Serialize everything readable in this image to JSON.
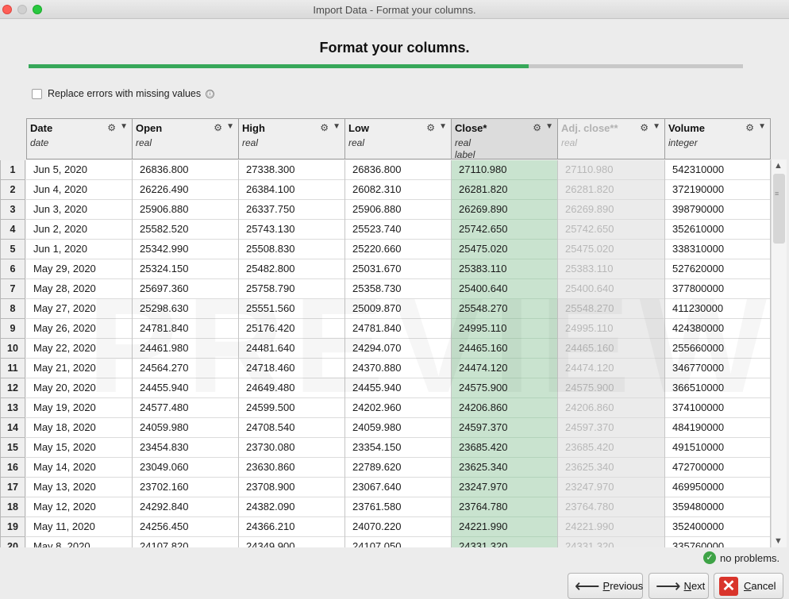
{
  "window": {
    "title": "Import Data - Format your columns."
  },
  "heading": "Format your columns.",
  "progress": {
    "percent": 70,
    "fill_color": "#37a85a"
  },
  "replace_errors": {
    "label": "Replace errors with missing values",
    "checked": false,
    "info_icon": "ⓘ"
  },
  "watermark": "PREVIEW",
  "columns": [
    {
      "name": "Date",
      "type": "date",
      "role": ""
    },
    {
      "name": "Open",
      "type": "real",
      "role": ""
    },
    {
      "name": "High",
      "type": "real",
      "role": ""
    },
    {
      "name": "Low",
      "type": "real",
      "role": ""
    },
    {
      "name": "Close*",
      "type": "real",
      "role": "label"
    },
    {
      "name": "Adj. close**",
      "type": "real",
      "role": ""
    },
    {
      "name": "Volume",
      "type": "integer",
      "role": ""
    }
  ],
  "rows": [
    {
      "n": "1",
      "cells": [
        "Jun 5, 2020",
        "26836.800",
        "27338.300",
        "26836.800",
        "27110.980",
        "27110.980",
        "542310000"
      ]
    },
    {
      "n": "2",
      "cells": [
        "Jun 4, 2020",
        "26226.490",
        "26384.100",
        "26082.310",
        "26281.820",
        "26281.820",
        "372190000"
      ]
    },
    {
      "n": "3",
      "cells": [
        "Jun 3, 2020",
        "25906.880",
        "26337.750",
        "25906.880",
        "26269.890",
        "26269.890",
        "398790000"
      ]
    },
    {
      "n": "4",
      "cells": [
        "Jun 2, 2020",
        "25582.520",
        "25743.130",
        "25523.740",
        "25742.650",
        "25742.650",
        "352610000"
      ]
    },
    {
      "n": "5",
      "cells": [
        "Jun 1, 2020",
        "25342.990",
        "25508.830",
        "25220.660",
        "25475.020",
        "25475.020",
        "338310000"
      ]
    },
    {
      "n": "6",
      "cells": [
        "May 29, 2020",
        "25324.150",
        "25482.800",
        "25031.670",
        "25383.110",
        "25383.110",
        "527620000"
      ]
    },
    {
      "n": "7",
      "cells": [
        "May 28, 2020",
        "25697.360",
        "25758.790",
        "25358.730",
        "25400.640",
        "25400.640",
        "377800000"
      ]
    },
    {
      "n": "8",
      "cells": [
        "May 27, 2020",
        "25298.630",
        "25551.560",
        "25009.870",
        "25548.270",
        "25548.270",
        "411230000"
      ]
    },
    {
      "n": "9",
      "cells": [
        "May 26, 2020",
        "24781.840",
        "25176.420",
        "24781.840",
        "24995.110",
        "24995.110",
        "424380000"
      ]
    },
    {
      "n": "10",
      "cells": [
        "May 22, 2020",
        "24461.980",
        "24481.640",
        "24294.070",
        "24465.160",
        "24465.160",
        "255660000"
      ]
    },
    {
      "n": "11",
      "cells": [
        "May 21, 2020",
        "24564.270",
        "24718.460",
        "24370.880",
        "24474.120",
        "24474.120",
        "346770000"
      ]
    },
    {
      "n": "12",
      "cells": [
        "May 20, 2020",
        "24455.940",
        "24649.480",
        "24455.940",
        "24575.900",
        "24575.900",
        "366510000"
      ]
    },
    {
      "n": "13",
      "cells": [
        "May 19, 2020",
        "24577.480",
        "24599.500",
        "24202.960",
        "24206.860",
        "24206.860",
        "374100000"
      ]
    },
    {
      "n": "14",
      "cells": [
        "May 18, 2020",
        "24059.980",
        "24708.540",
        "24059.980",
        "24597.370",
        "24597.370",
        "484190000"
      ]
    },
    {
      "n": "15",
      "cells": [
        "May 15, 2020",
        "23454.830",
        "23730.080",
        "23354.150",
        "23685.420",
        "23685.420",
        "491510000"
      ]
    },
    {
      "n": "16",
      "cells": [
        "May 14, 2020",
        "23049.060",
        "23630.860",
        "22789.620",
        "23625.340",
        "23625.340",
        "472700000"
      ]
    },
    {
      "n": "17",
      "cells": [
        "May 13, 2020",
        "23702.160",
        "23708.900",
        "23067.640",
        "23247.970",
        "23247.970",
        "469950000"
      ]
    },
    {
      "n": "18",
      "cells": [
        "May 12, 2020",
        "24292.840",
        "24382.090",
        "23761.580",
        "23764.780",
        "23764.780",
        "359480000"
      ]
    },
    {
      "n": "19",
      "cells": [
        "May 11, 2020",
        "24256.450",
        "24366.210",
        "24070.220",
        "24221.990",
        "24221.990",
        "352400000"
      ]
    },
    {
      "n": "20",
      "cells": [
        "May 8, 2020",
        "24107.820",
        "24349.900",
        "24107.050",
        "24331.320",
        "24331.320",
        "335760000"
      ]
    }
  ],
  "status": {
    "text": "no problems.",
    "icon": "check-icon"
  },
  "buttons": {
    "previous": "Previous",
    "next": "Next",
    "cancel": "Cancel"
  }
}
